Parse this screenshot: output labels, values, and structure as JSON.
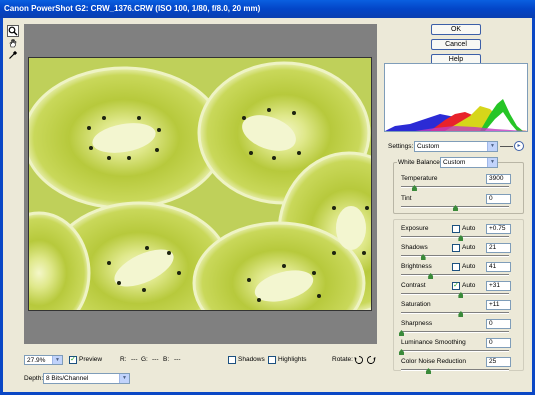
{
  "window": {
    "title": "Canon PowerShot G2:  CRW_1376.CRW  (ISO 100, 1/80, f/8.0, 20 mm)"
  },
  "tools": [
    {
      "icon": "zoom-icon"
    },
    {
      "icon": "hand-icon"
    },
    {
      "icon": "eyedropper-icon"
    }
  ],
  "buttons": {
    "ok": "OK",
    "cancel": "Cancel",
    "help": "Help"
  },
  "settings": {
    "label": "Settings:",
    "value": "Custom"
  },
  "white_balance": {
    "label": "White Balance:",
    "value": "Custom"
  },
  "sliders": {
    "temperature": {
      "label": "Temperature",
      "value": "3900",
      "level": 0.12
    },
    "tint": {
      "label": "Tint",
      "value": "0",
      "level": 0.5
    },
    "exposure": {
      "label": "Exposure",
      "value": "+0.75",
      "auto_label": "Auto",
      "auto": false,
      "level": 0.55
    },
    "shadows": {
      "label": "Shadows",
      "value": "21",
      "auto_label": "Auto",
      "auto": false,
      "level": 0.2
    },
    "brightness": {
      "label": "Brightness",
      "value": "41",
      "auto_label": "Auto",
      "auto": false,
      "level": 0.27
    },
    "contrast": {
      "label": "Contrast",
      "value": "+31",
      "auto_label": "Auto",
      "auto": true,
      "level": 0.55
    },
    "saturation": {
      "label": "Saturation",
      "value": "+11",
      "level": 0.55
    },
    "sharpness": {
      "label": "Sharpness",
      "value": "0",
      "level": 0.0
    },
    "luminance_smoothing": {
      "label": "Luminance Smoothing",
      "value": "0",
      "level": 0.0
    },
    "color_noise_reduction": {
      "label": "Color Noise Reduction",
      "value": "25",
      "level": 0.25
    }
  },
  "bottom": {
    "zoom": "27.9%",
    "preview_label": "Preview",
    "preview_checked": true,
    "r_label": "R:",
    "r_value": "---",
    "g_label": "G:",
    "g_value": "---",
    "b_label": "B:",
    "b_value": "---",
    "shadows_label": "Shadows",
    "highlights_label": "Highlights",
    "rotate_label": "Rotate:"
  },
  "depth": {
    "label": "Depth:",
    "value": "8 Bits/Channel"
  },
  "colors": {
    "title_bar": "#0345c7",
    "dialog_bg": "#ece9d8",
    "preview_bg": "#808080",
    "button_border": "#3c5fa8"
  }
}
